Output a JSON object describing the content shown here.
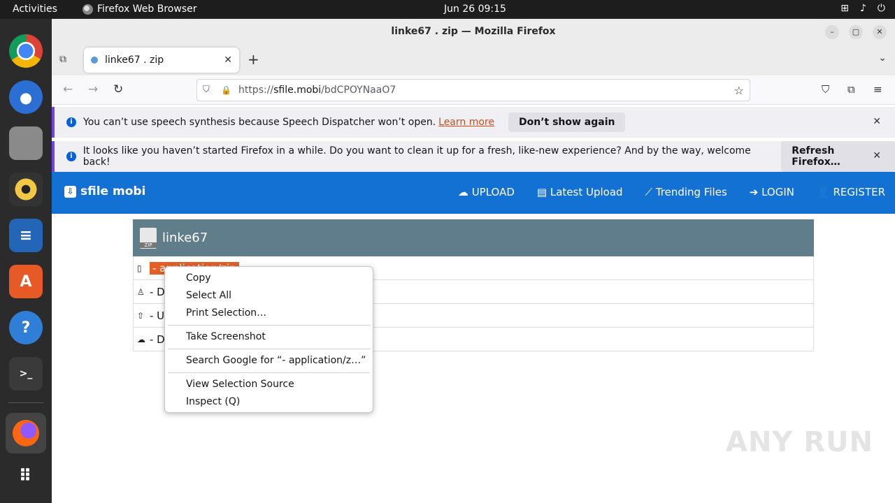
{
  "topbar": {
    "activities": "Activities",
    "app_name": "Firefox Web Browser",
    "clock": "Jun 26  09:15"
  },
  "window": {
    "title": "linke67 . zip — Mozilla Firefox"
  },
  "tab": {
    "title": "linke67 . zip"
  },
  "url": {
    "prefix": "https://",
    "domain": "sfile.mobi",
    "path": "/bdCPOYNaaO7"
  },
  "infobars": [
    {
      "message": "You can’t use speech synthesis because Speech Dispatcher won’t open.",
      "link": "Learn more",
      "button": "Don’t show again"
    },
    {
      "message": "It looks like you haven’t started Firefox in a while. Do you want to clean it up for a fresh, like-new experience? And by the way, welcome back!",
      "button": "Refresh Firefox…"
    }
  ],
  "site": {
    "logo": "sfile mobi",
    "nav": [
      "UPLOAD",
      "Latest Upload",
      "Trending Files",
      "LOGIN",
      "REGISTER"
    ]
  },
  "file": {
    "name": "linke67",
    "zip_label": "ZIP",
    "rows": [
      "- application/zip",
      "- D",
      "- U",
      "- Do"
    ]
  },
  "context_menu": {
    "items": [
      "Copy",
      "Select All",
      "Print Selection…",
      "Take Screenshot",
      "Search Google for “- application/z…”",
      "View Selection Source",
      "Inspect (Q)"
    ]
  },
  "watermark": "ANY RUN"
}
